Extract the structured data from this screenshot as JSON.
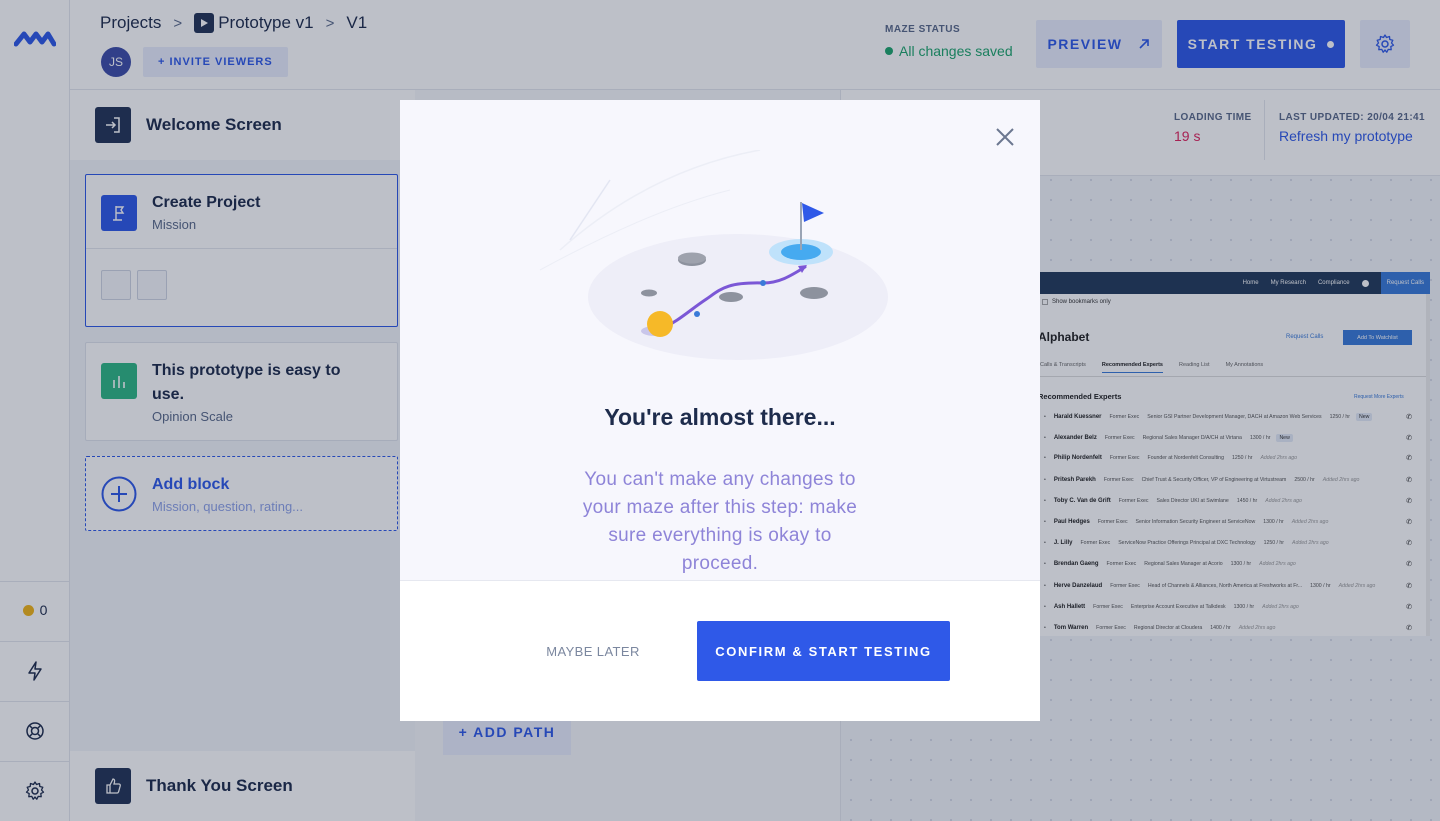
{
  "header": {
    "breadcrumb": [
      "Projects",
      "Prototype v1",
      "V1"
    ],
    "avatar_initials": "JS",
    "invite_label": "+ INVITE VIEWERS",
    "maze_status_label": "MAZE STATUS",
    "maze_status_value": "All changes saved",
    "preview_label": "PREVIEW",
    "start_testing_label": "START TESTING"
  },
  "sidebar": {
    "credits": "0"
  },
  "blocks": {
    "welcome": "Welcome Screen",
    "items": [
      {
        "title": "Create Project",
        "subtitle": "Mission"
      },
      {
        "title": "This prototype is easy to use.",
        "subtitle": "Opinion Scale"
      }
    ],
    "add_block_title": "Add block",
    "add_block_subtitle": "Mission, question, rating...",
    "thank_you": "Thank You Screen",
    "add_path_label": "+ ADD PATH"
  },
  "preview_panel": {
    "loading_time_label": "LOADING TIME",
    "loading_time_value": "19 s",
    "last_updated_label": "LAST UPDATED: 20/04 21:41",
    "refresh_label": "Refresh my prototype",
    "screenshot": {
      "nav_items": [
        "Home",
        "My Research",
        "Compliance"
      ],
      "request_calls": "Request Calls",
      "show_bookmarks": "Show bookmarks only",
      "company": "Alphabet",
      "request_calls_link": "Request Calls",
      "add_watchlist": "Add To Watchlist",
      "tabs": [
        "Calls & Transcripts",
        "Recommended Experts",
        "Reading List",
        "My Annotations"
      ],
      "section_title": "Recommended Experts",
      "request_more": "Request More Experts",
      "experts": [
        {
          "name": "Harald Kuessner",
          "role": "Former Exec",
          "title": "Senior GSI Partner Development Manager, DACH at Amazon Web Services",
          "rate": "1250 / hr",
          "tag": "New"
        },
        {
          "name": "Alexander Belz",
          "role": "Former Exec",
          "title": "Regional Sales Manager D/A/CH at Virtana",
          "rate": "1300 / hr",
          "tag": "New"
        },
        {
          "name": "Philip Nordenfelt",
          "role": "Former Exec",
          "title": "Founder at Nordenfelt Consulting",
          "rate": "1250 / hr",
          "added": "Added 2hrs ago"
        },
        {
          "name": "Pritesh Parekh",
          "role": "Former Exec",
          "title": "Chief Trust & Security Officer, VP of Engineering at Virtustream",
          "rate": "2500 / hr",
          "added": "Added 2hrs ago"
        },
        {
          "name": "Toby C. Van de Grift",
          "role": "Former Exec",
          "title": "Sales Director UKI at Swimlane",
          "rate": "1450 / hr",
          "added": "Added 2hrs ago"
        },
        {
          "name": "Paul Hedges",
          "role": "Former Exec",
          "title": "Senior Information Security Engineer at ServiceNow",
          "rate": "1300 / hr",
          "added": "Added 2hrs ago"
        },
        {
          "name": "J. Lilly",
          "role": "Former Exec",
          "title": "ServiceNow Practice Offerings Principal at DXC Technology",
          "rate": "1250 / hr",
          "added": "Added 2hrs ago"
        },
        {
          "name": "Brendan Gaeng",
          "role": "Former Exec",
          "title": "Regional Sales Manager at Acorio",
          "rate": "1300 / hr",
          "added": "Added 2hrs ago"
        },
        {
          "name": "Herve Danzelaud",
          "role": "Former Exec",
          "title": "Head of Channels & Alliances, North America at Freshworks at Fr...",
          "rate": "1300 / hr",
          "added": "Added 2hrs ago"
        },
        {
          "name": "Ash Hallett",
          "role": "Former Exec",
          "title": "Enterprise Account Executive at Talkdesk",
          "rate": "1300 / hr",
          "added": "Added 2hrs ago"
        },
        {
          "name": "Tom Warren",
          "role": "Former Exec",
          "title": "Regional Director at Cloudera",
          "rate": "1400 / hr",
          "added": "Added 2hrs ago"
        }
      ]
    }
  },
  "modal": {
    "title": "You're almost there...",
    "description": "You can't make any changes to your maze after this step: make sure everything is okay to proceed.",
    "later_label": "MAYBE LATER",
    "confirm_label": "CONFIRM & START TESTING"
  },
  "colors": {
    "accent": "#2f59e8",
    "success": "#1ea56c",
    "loading_time": "#e0245e",
    "modal_text": "#8e84d8"
  }
}
